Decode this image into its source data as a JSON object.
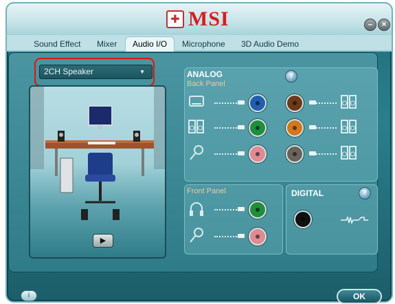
{
  "window": {
    "brand": "MSI",
    "minimize_label": "–",
    "close_label": "×"
  },
  "tabs": [
    {
      "label": "Sound Effect",
      "active": false
    },
    {
      "label": "Mixer",
      "active": false
    },
    {
      "label": "Audio I/O",
      "active": true
    },
    {
      "label": "Microphone",
      "active": false
    },
    {
      "label": "3D Audio Demo",
      "active": false
    }
  ],
  "speaker_select": {
    "value": "2CH Speaker",
    "arrow": "▼"
  },
  "analog": {
    "title": "ANALOG",
    "back_panel_label": "Back Panel",
    "front_panel_label": "Front Panel",
    "info_icon": "info-icon"
  },
  "digital": {
    "title": "DIGITAL",
    "info_icon": "info-icon"
  },
  "jacks": {
    "back_left": [
      {
        "device": "line-in-icon",
        "color": "#1f5fb0"
      },
      {
        "device": "speaker-icon",
        "color": "#1f8f3b"
      },
      {
        "device": "microphone-icon",
        "color": "#e08a93"
      }
    ],
    "back_right": [
      {
        "device": "speaker-icon",
        "color": "#6b3a1a"
      },
      {
        "device": "speaker-icon",
        "color": "#d2771f"
      },
      {
        "device": "speaker-icon",
        "color": "#6a625c"
      }
    ],
    "front": [
      {
        "device": "headphone-icon",
        "color": "#1f8f3b"
      },
      {
        "device": "microphone-icon",
        "color": "#e08a93"
      }
    ],
    "digital_color": "#111111"
  },
  "buttons": {
    "ok": "OK",
    "play": "▶",
    "help": "i"
  }
}
